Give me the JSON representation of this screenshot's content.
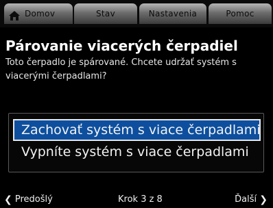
{
  "tabs": {
    "home": "Domov",
    "status": "Stav",
    "settings": "Nastavenia",
    "help": "Pomoc"
  },
  "header": {
    "title": "Párovanie viacerých čerpadiel",
    "subtitle": "Toto čerpadlo je spárované. Chcete udržať systém s viacerými čerpadlami?"
  },
  "options": [
    {
      "label": "Zachovať systém s viace čerpadlami",
      "selected": true
    },
    {
      "label": "Vypníte systém s viace čerpadlami",
      "selected": false
    }
  ],
  "footer": {
    "prev": "Predošlý",
    "step": "Krok 3 z 8",
    "next": "Ďalší"
  },
  "colors": {
    "selection": "#0d4f9e",
    "background": "#000000"
  }
}
